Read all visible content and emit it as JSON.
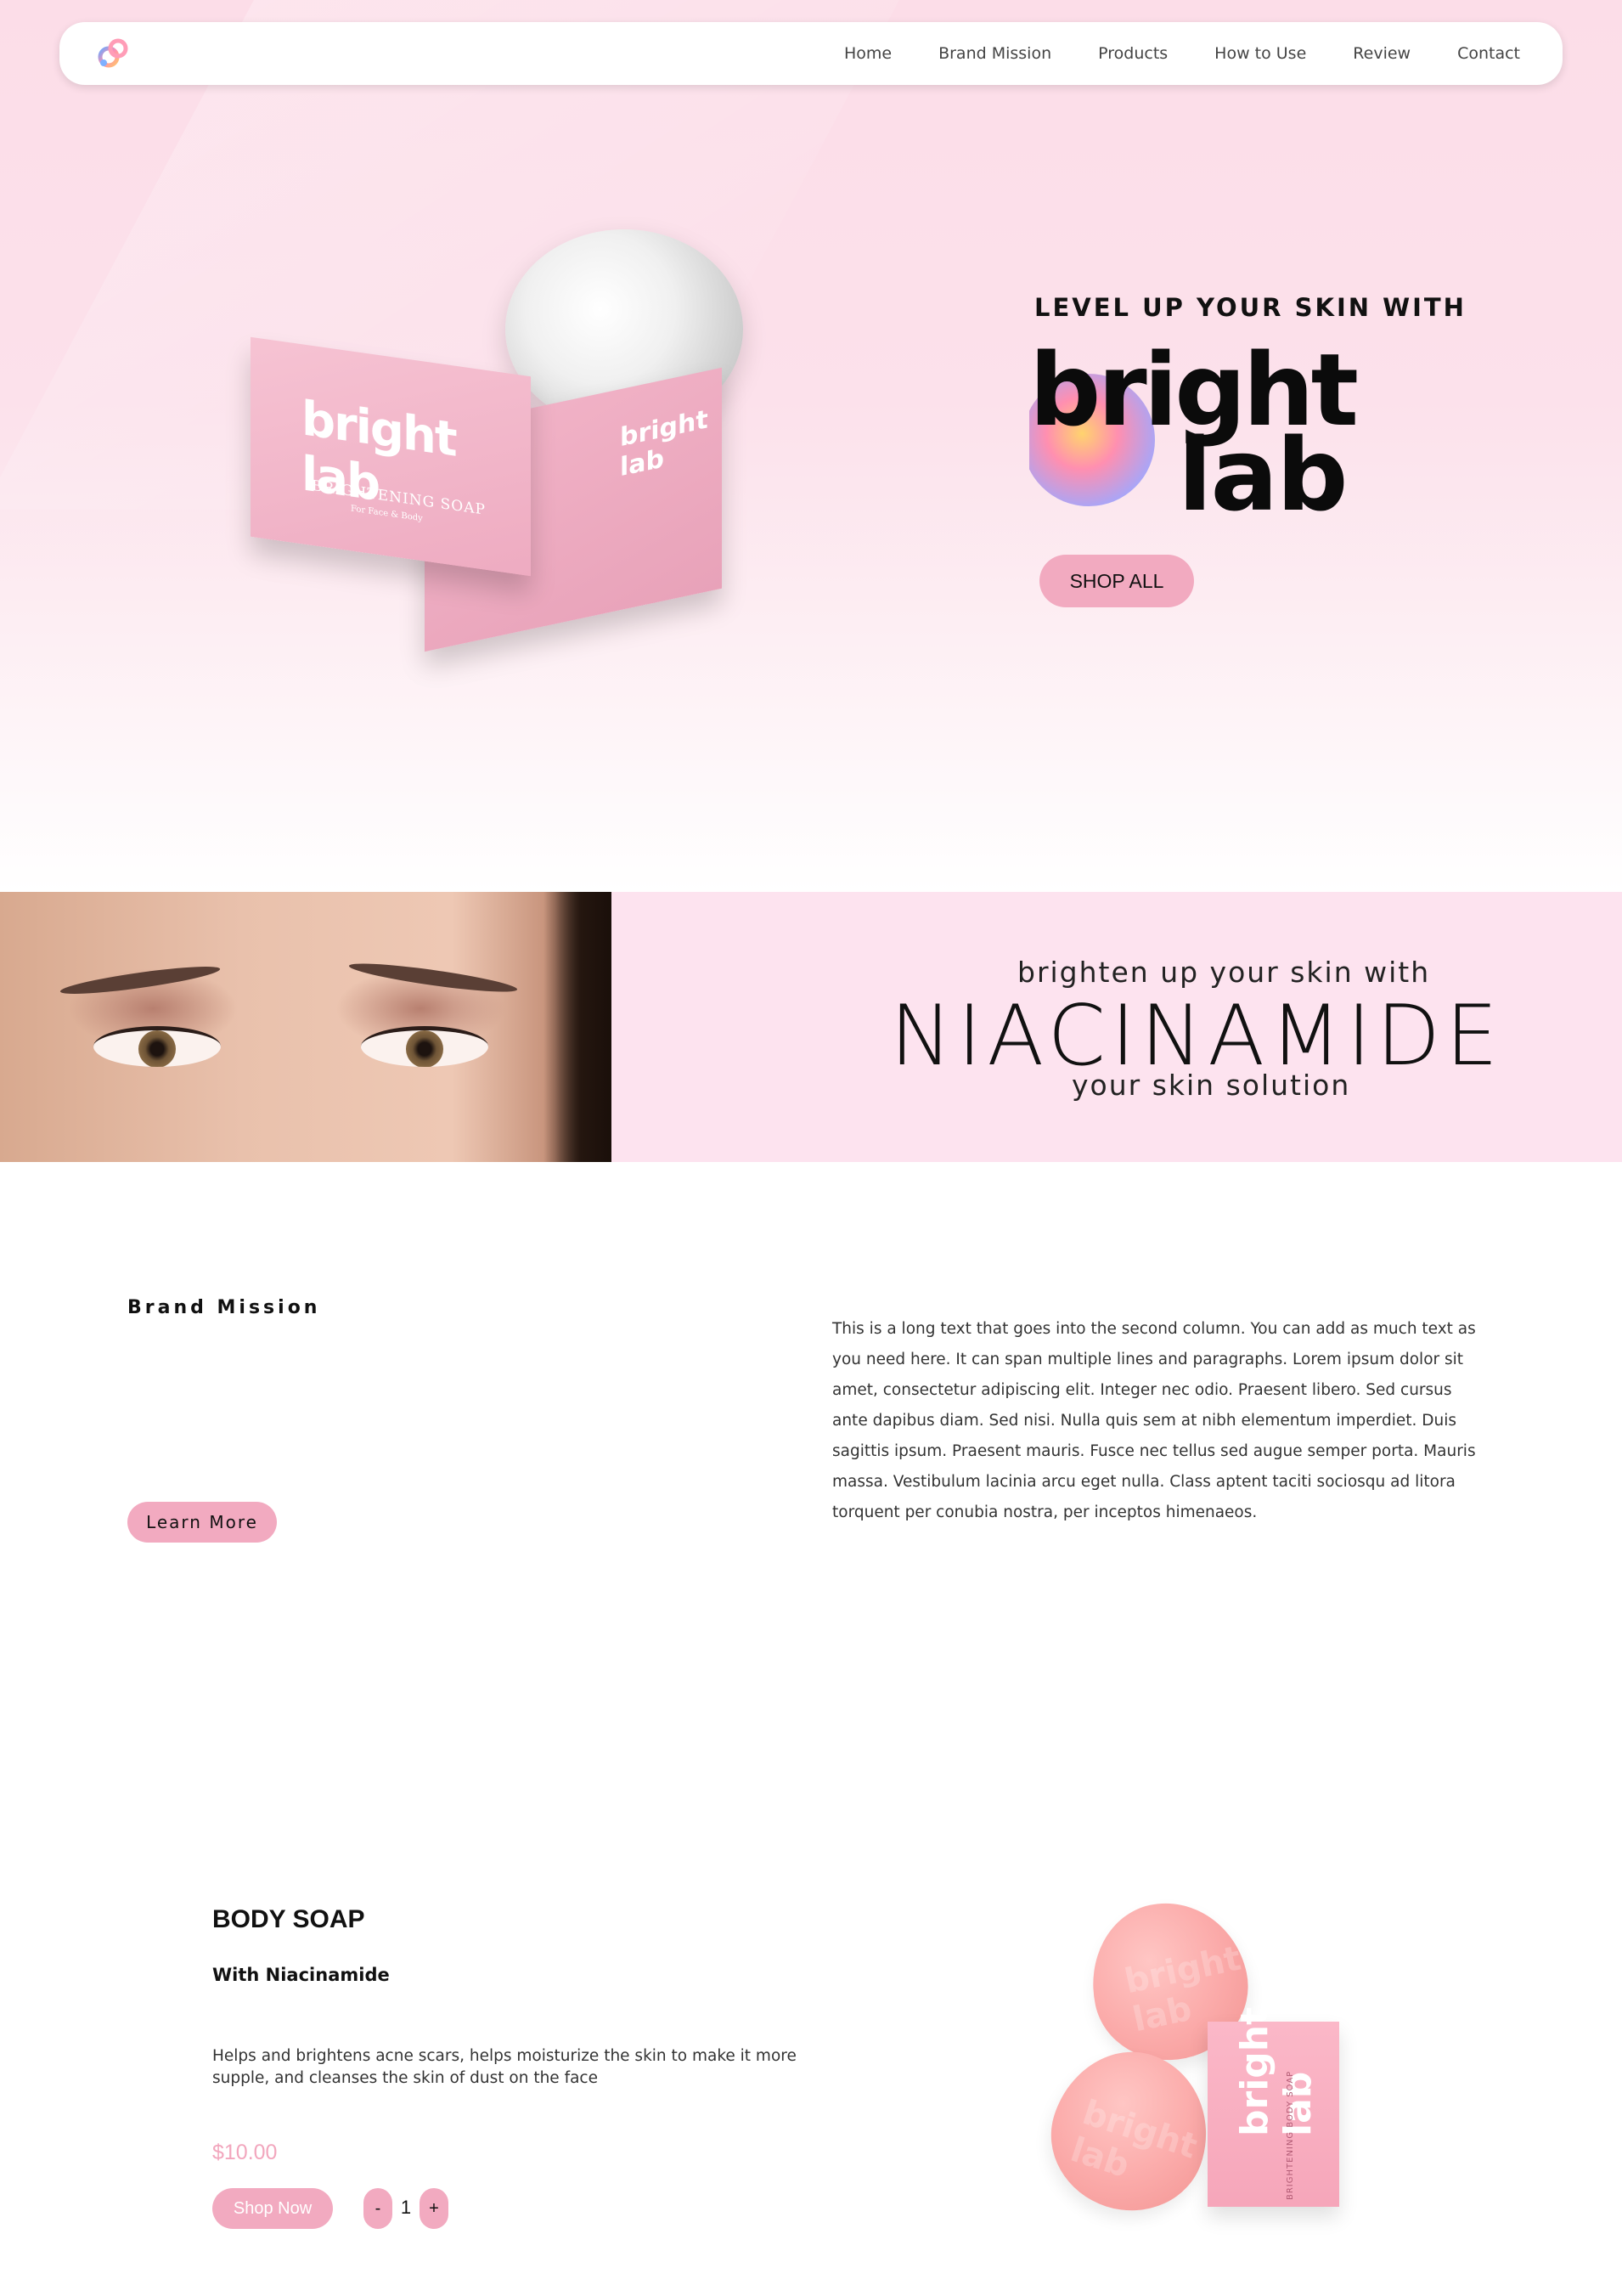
{
  "nav": {
    "items": [
      {
        "label": "Home"
      },
      {
        "label": "Brand Mission"
      },
      {
        "label": "Products"
      },
      {
        "label": "How to Use"
      },
      {
        "label": "Review"
      },
      {
        "label": "Contact"
      }
    ]
  },
  "hero": {
    "tagline": "LEVEL UP YOUR SKIN WITH",
    "logo_word_1": "bright",
    "logo_word_2": "lab",
    "shop_all_label": "SHOP ALL",
    "box_logo": "bright lab",
    "box_text": "BRIGHTENING SOAP",
    "box_sub": "For Face & Body"
  },
  "banner": {
    "line1": "brighten up your skin with",
    "line2": "NIACINAMIDE",
    "line3": "your skin solution"
  },
  "mission": {
    "heading": "Brand Mission",
    "learn_more_label": "Learn More",
    "body": "This is a long text that goes into the second column. You can add as much text as you need here. It can span multiple lines and paragraphs. Lorem ipsum dolor sit amet, consectetur adipiscing elit. Integer nec odio. Praesent libero. Sed cursus ante dapibus diam. Sed nisi. Nulla quis sem at nibh elementum imperdiet. Duis sagittis ipsum. Praesent mauris. Fusce nec tellus sed augue semper porta. Mauris massa. Vestibulum lacinia arcu eget nulla. Class aptent taciti sociosqu ad litora torquent per conubia nostra, per inceptos himenaeos."
  },
  "product": {
    "title": "BODY SOAP",
    "subtitle": "With Niacinamide",
    "description": "Helps and brightens acne scars, helps moisturize the skin to make it more supple, and cleanses the skin of dust on the face",
    "price": "$10.00",
    "shop_now_label": "Shop Now",
    "qty_minus": "-",
    "qty_plus": "+",
    "quantity": "1",
    "box_logo": "bright lab",
    "box_text": "BRIGHTENING BODY SOAP"
  },
  "colors": {
    "accent_pink": "#f2aac0",
    "hero_bg": "#fcdde8",
    "banner_bg": "#fde3ef",
    "price_pink": "#f2a6bd"
  },
  "icons": {
    "nav_logo": "brand-logo-icon"
  }
}
